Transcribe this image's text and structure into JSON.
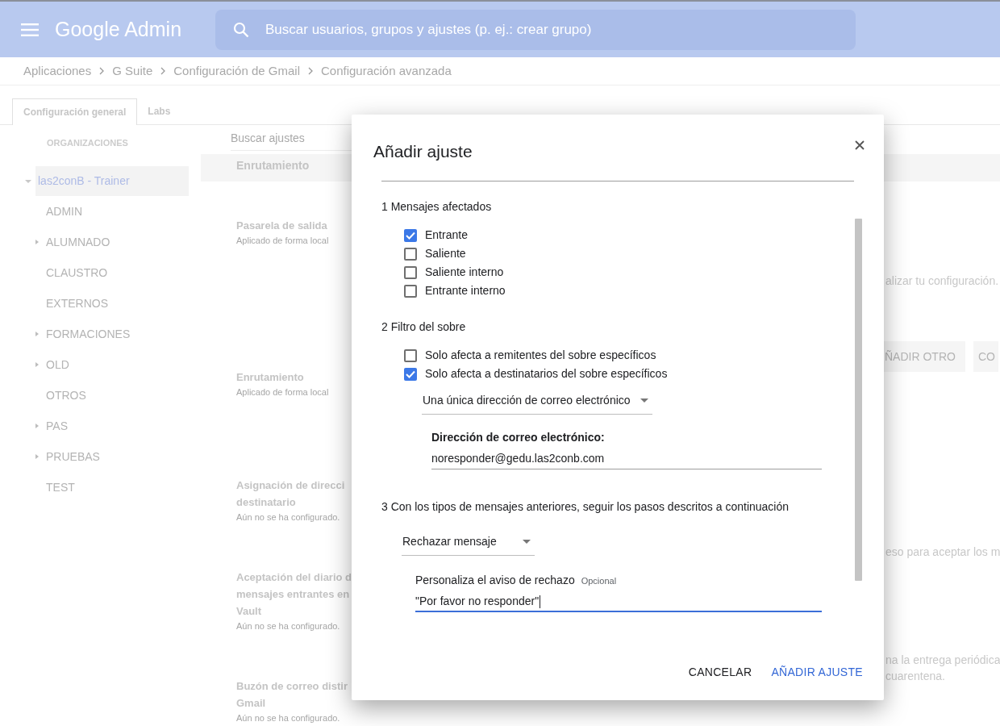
{
  "header": {
    "app_name": "Google Admin",
    "search_placeholder": "Buscar usuarios, grupos y ajustes (p. ej.: crear grupo)"
  },
  "breadcrumb": [
    "Aplicaciones",
    "G Suite",
    "Configuración de Gmail",
    "Configuración avanzada"
  ],
  "tabs": [
    {
      "label": "Configuración general",
      "selected": true
    },
    {
      "label": "Labs",
      "selected": false
    }
  ],
  "sidebar": {
    "heading": "ORGANIZACIONES",
    "root": {
      "label": "las2conB - Trainer",
      "expanded": true,
      "selected": true,
      "children": [
        {
          "label": "ADMIN",
          "expandable": false
        },
        {
          "label": "ALUMNADO",
          "expandable": true
        },
        {
          "label": "CLAUSTRO",
          "expandable": false
        },
        {
          "label": "EXTERNOS",
          "expandable": false
        },
        {
          "label": "FORMACIONES",
          "expandable": true
        },
        {
          "label": "OLD",
          "expandable": true
        },
        {
          "label": "OTROS",
          "expandable": false
        },
        {
          "label": "PAS",
          "expandable": true
        },
        {
          "label": "PRUEBAS",
          "expandable": true
        },
        {
          "label": "TEST",
          "expandable": false
        }
      ]
    }
  },
  "content": {
    "search_placeholder": "Buscar ajustes",
    "section": "Enrutamiento",
    "settings": [
      {
        "title_lines": [
          "Pasarela de salida"
        ],
        "status": "Aplicado de forma local"
      },
      {
        "title_lines": [
          "Enrutamiento"
        ],
        "status": "Aplicado de forma local"
      },
      {
        "title_lines": [
          "Asignación de direcci",
          "destinatario"
        ],
        "status": "Aún no se ha configurado."
      },
      {
        "title_lines": [
          "Aceptación del diario d",
          "mensajes entrantes en",
          "Vault"
        ],
        "status": "Aún no se ha configurado."
      },
      {
        "title_lines": [
          "Buzón de correo distir",
          "Gmail"
        ],
        "status": "Aún no se ha configurado."
      }
    ],
    "right_fragments": [
      {
        "kind": "text",
        "text": "alizar tu configuración."
      },
      {
        "kind": "buttons",
        "labels": [
          "ÑADIR OTRO",
          "CO"
        ]
      },
      {
        "kind": "text",
        "text": "eso para aceptar los m"
      },
      {
        "kind": "text",
        "text": "na la entrega periódica"
      },
      {
        "kind": "text",
        "text": "cuarentena."
      }
    ]
  },
  "dialog": {
    "title": "Añadir ajuste",
    "sections": [
      {
        "heading": "1 Mensajes afectados",
        "options": [
          {
            "label": "Entrante",
            "checked": true
          },
          {
            "label": "Saliente",
            "checked": false
          },
          {
            "label": "Saliente interno",
            "checked": false
          },
          {
            "label": "Entrante interno",
            "checked": false
          }
        ]
      },
      {
        "heading": "2 Filtro del sobre",
        "options": [
          {
            "label": "Solo afecta a remitentes del sobre específicos",
            "checked": false
          },
          {
            "label": "Solo afecta a destinatarios del sobre específicos",
            "checked": true
          }
        ],
        "dropdown": "Una única dirección de correo electrónico",
        "field": {
          "label": "Dirección de correo electrónico:",
          "value": "noresponder@gedu.las2conb.com",
          "focused": false
        }
      },
      {
        "heading": "3 Con los tipos de mensajes anteriores, seguir los pasos descritos a continuación",
        "dropdown": "Rechazar mensaje",
        "field": {
          "label": "Personaliza el aviso de rechazo",
          "hint": "Opcional",
          "value": "\"Por favor no responder\"",
          "focused": true
        }
      }
    ],
    "buttons": [
      {
        "label": "CANCELAR",
        "primary": false
      },
      {
        "label": "AÑADIR AJUSTE",
        "primary": true
      }
    ]
  }
}
